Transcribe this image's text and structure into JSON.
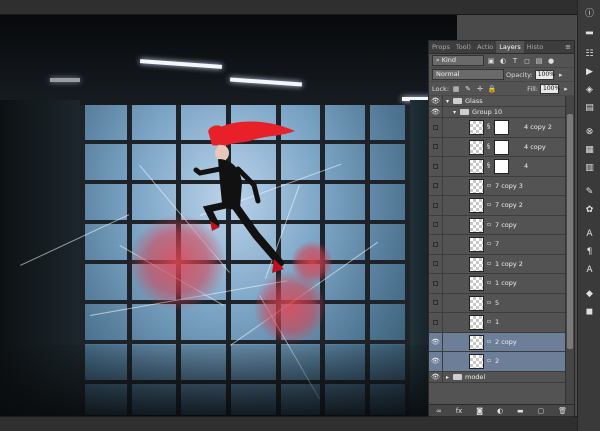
{
  "panel": {
    "tabs": [
      {
        "label": "Props"
      },
      {
        "label": "Tool)"
      },
      {
        "label": "Actio"
      },
      {
        "label": "Layers"
      },
      {
        "label": "Histo"
      }
    ],
    "kind_filter": "Kind",
    "blend_mode": "Normal",
    "opacity_label": "Opacity:",
    "opacity_value": "100%",
    "lock_label": "Lock:",
    "fill_label": "Fill:",
    "fill_value": "100%",
    "layers": [
      {
        "name": "Glass",
        "type": "group",
        "visible": true,
        "indent": 0,
        "selected": false
      },
      {
        "name": "Group 10",
        "type": "group",
        "visible": true,
        "indent": 1,
        "selected": false
      },
      {
        "name": "4 copy 2",
        "type": "layer",
        "visible": false,
        "mask": true,
        "selected": false
      },
      {
        "name": "4 copy",
        "type": "layer",
        "visible": false,
        "mask": true,
        "selected": false
      },
      {
        "name": "4",
        "type": "layer",
        "visible": false,
        "mask": true,
        "selected": false
      },
      {
        "name": "7 copy 3",
        "type": "layer",
        "visible": false,
        "mask": false,
        "selected": false
      },
      {
        "name": "7 copy 2",
        "type": "layer",
        "visible": false,
        "mask": false,
        "selected": false
      },
      {
        "name": "7 copy",
        "type": "layer",
        "visible": false,
        "mask": false,
        "selected": false
      },
      {
        "name": "7",
        "type": "layer",
        "visible": false,
        "mask": false,
        "selected": false
      },
      {
        "name": "1 copy 2",
        "type": "layer",
        "visible": false,
        "mask": false,
        "selected": false
      },
      {
        "name": "1 copy",
        "type": "layer",
        "visible": false,
        "mask": false,
        "selected": false
      },
      {
        "name": "5",
        "type": "layer",
        "visible": false,
        "mask": false,
        "selected": false
      },
      {
        "name": "1",
        "type": "layer",
        "visible": false,
        "mask": false,
        "selected": false
      },
      {
        "name": "2 copy",
        "type": "layer",
        "visible": true,
        "mask": false,
        "selected": true
      },
      {
        "name": "2",
        "type": "layer",
        "visible": true,
        "mask": false,
        "selected": true
      },
      {
        "name": "model",
        "type": "group",
        "visible": true,
        "indent": 0,
        "selected": false
      }
    ],
    "footer_icons": [
      "link-icon",
      "fx-icon",
      "mask-icon",
      "adjustment-icon",
      "folder-icon",
      "new-layer-icon",
      "trash-icon"
    ]
  },
  "toolstrip_icons": [
    "info-icon",
    "histogram-icon",
    "adjust-icon",
    "play-icon",
    "layers-icon",
    "history-icon",
    "channels-icon",
    "swatches-icon",
    "paths-icon",
    "brush-icon",
    "text-icon",
    "paragraph-icon",
    "clone-icon",
    "styles-icon",
    "3d-icon",
    "camera-icon"
  ],
  "colors": {
    "panel_bg": "#535353",
    "selected_row": "#6c7e98",
    "hair_red": "#e8202a",
    "blob_red": "#e04656"
  }
}
